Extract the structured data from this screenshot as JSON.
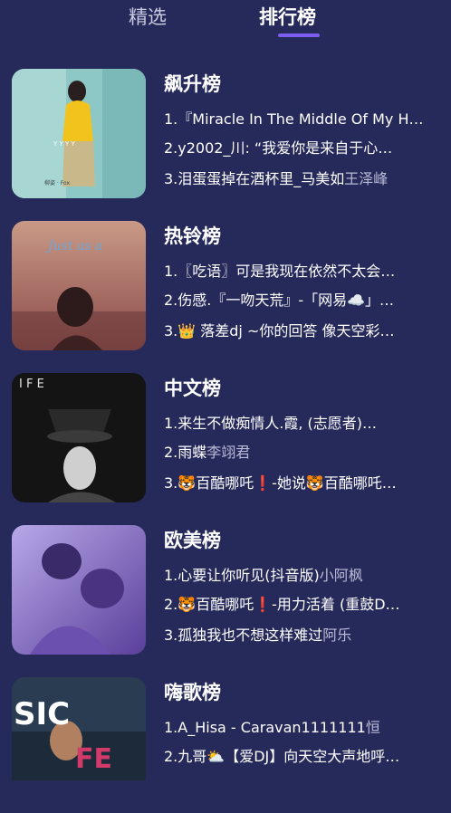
{
  "tabs": [
    {
      "label": "精选",
      "active": false
    },
    {
      "label": "排行榜",
      "active": true
    }
  ],
  "accent_color": "#7d5cf0",
  "background_color": "#262a5b",
  "charts": [
    {
      "name": "飙升榜",
      "cover": {
        "text": "Y  Y  Y  Y",
        "caption": "柳姿 · Fox"
      },
      "tracks": [
        {
          "title": "1.『Miracle In The Middle Of My H…",
          "artist": ""
        },
        {
          "title": "2.y2002_川: “我爱你是来自于心…",
          "artist": ""
        },
        {
          "title": "3.泪蛋蛋掉在酒杯里_马美如",
          "artist": "王泽峰"
        }
      ]
    },
    {
      "name": "热铃榜",
      "cover": {
        "text": "Just as a",
        "caption": ""
      },
      "tracks": [
        {
          "title": "1.〖吃语〗可是我现在依然不太会…",
          "artist": ""
        },
        {
          "title": "2.伤感.『一吻天荒』-「网易☁️」…",
          "artist": ""
        },
        {
          "title": "3.👑 落差dj ~你的回答 像天空彩…",
          "artist": ""
        }
      ]
    },
    {
      "name": "中文榜",
      "cover": {
        "text": "I  F  E",
        "caption": ""
      },
      "tracks": [
        {
          "title": "1.来生不做痴情人.霞, (志愿者)…",
          "artist": ""
        },
        {
          "title": "2.雨蝶",
          "artist": "李翊君"
        },
        {
          "title": "3.🐯百酷哪吒❗-她说🐯百酷哪吒…",
          "artist": ""
        }
      ]
    },
    {
      "name": "欧美榜",
      "cover": {
        "text": "",
        "caption": ""
      },
      "tracks": [
        {
          "title": "1.心要让你听见(抖音版)",
          "artist": "小阿枫"
        },
        {
          "title": "2.🐯百酷哪吒❗-用力活着 (重鼓D…",
          "artist": ""
        },
        {
          "title": "3.孤独我也不想这样难过",
          "artist": "阿乐"
        }
      ]
    },
    {
      "name": "嗨歌榜",
      "cover": {
        "text": "SIC",
        "caption": "FE"
      },
      "tracks": [
        {
          "title": "1.A_Hisa - Caravan1111111",
          "artist": "恒"
        },
        {
          "title": "2.九哥⛅【爱DJ】向天空大声地呼…",
          "artist": ""
        }
      ]
    }
  ]
}
